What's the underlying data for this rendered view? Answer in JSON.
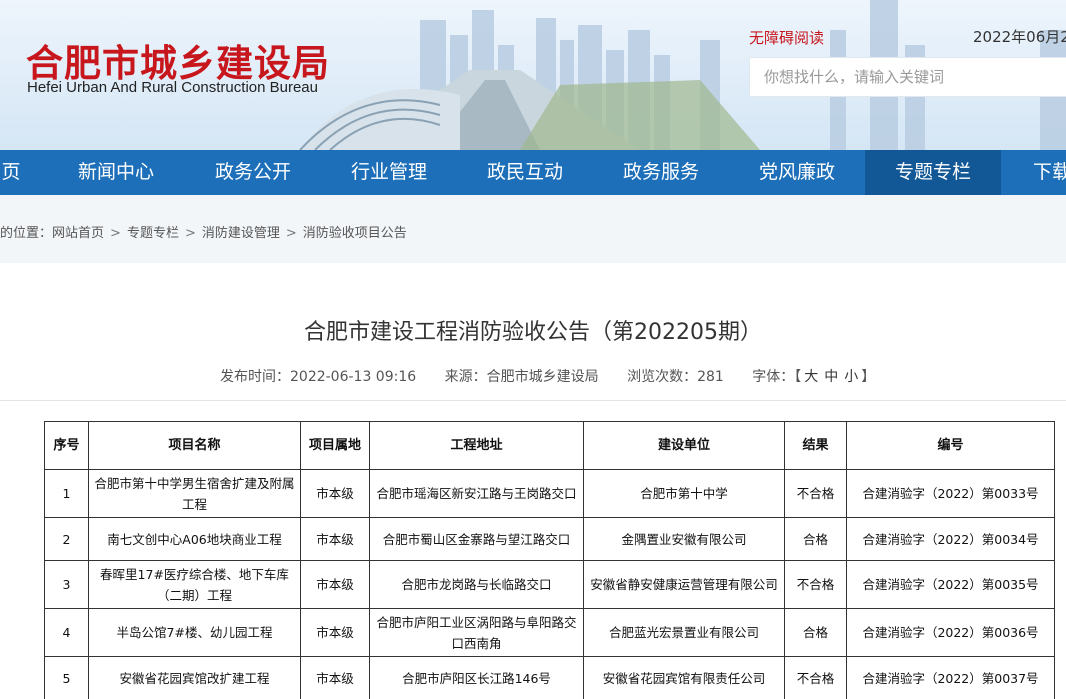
{
  "header": {
    "logo_cn": "合肥市城乡建设局",
    "logo_en": "Hefei Urban And Rural Construction Bureau",
    "accessibility_link": "无障碍阅读",
    "date": "2022年06月2",
    "search_placeholder": "你想找什么，请输入关键词"
  },
  "nav": {
    "items": [
      "页",
      "新闻中心",
      "政务公开",
      "行业管理",
      "政民互动",
      "政务服务",
      "党风廉政",
      "专题专栏",
      "下载"
    ],
    "active": "专题专栏"
  },
  "breadcrumb": {
    "prefix": "的位置：",
    "items": [
      "网站首页",
      "专题专栏",
      "消防建设管理",
      "消防验收项目公告"
    ]
  },
  "article": {
    "title": "合肥市建设工程消防验收公告（第202205期）",
    "publish_time": "发布时间：2022-06-13 09:16",
    "source": "来源：合肥市城乡建设局",
    "views": "浏览次数：281",
    "font_label": "字体：",
    "font_open": "【",
    "font_large": "大",
    "font_medium": "中",
    "font_small": "小",
    "font_close": "】"
  },
  "table": {
    "headers": [
      "序号",
      "项目名称",
      "项目属地",
      "工程地址",
      "建设单位",
      "结果",
      "编号"
    ],
    "rows": [
      [
        "1",
        "合肥市第十中学男生宿舍扩建及附属工程",
        "市本级",
        "合肥市瑶海区新安江路与王岗路交口",
        "合肥市第十中学",
        "不合格",
        "合建消验字（2022）第0033号"
      ],
      [
        "2",
        "南七文创中心A06地块商业工程",
        "市本级",
        "合肥市蜀山区金寨路与望江路交口",
        "金隅置业安徽有限公司",
        "合格",
        "合建消验字（2022）第0034号"
      ],
      [
        "3",
        "春晖里17#医疗综合楼、地下车库（二期）工程",
        "市本级",
        "合肥市龙岗路与长临路交口",
        "安徽省静安健康运营管理有限公司",
        "不合格",
        "合建消验字（2022）第0035号"
      ],
      [
        "4",
        "半岛公馆7#楼、幼儿园工程",
        "市本级",
        "合肥市庐阳工业区涡阳路与阜阳路交口西南角",
        "合肥蓝光宏景置业有限公司",
        "合格",
        "合建消验字（2022）第0036号"
      ],
      [
        "5",
        "安徽省花园宾馆改扩建工程",
        "市本级",
        "合肥市庐阳区长江路146号",
        "安徽省花园宾馆有限责任公司",
        "不合格",
        "合建消验字（2022）第0037号"
      ]
    ]
  },
  "colors": {
    "brand_red": "#c8161d",
    "nav_blue": "#1c6fb8",
    "nav_active": "#135896"
  }
}
